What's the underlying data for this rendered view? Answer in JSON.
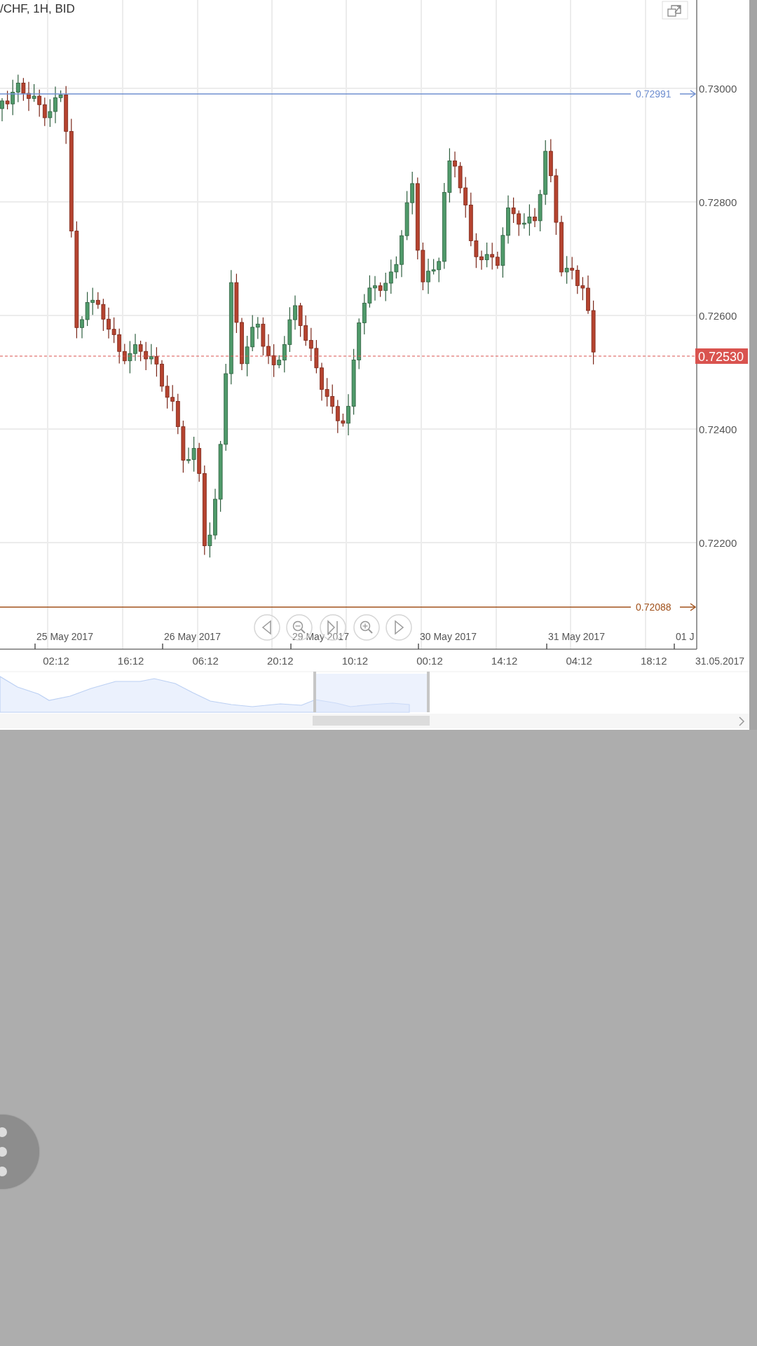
{
  "chart": {
    "title": "/CHF, 1H, BID",
    "y_labels": [
      "0.73000",
      "0.72800",
      "0.72600",
      "0.72400",
      "0.72200"
    ],
    "price_lines": [
      {
        "kind": "high",
        "label": "0.72991",
        "color": "#6f8fd0"
      },
      {
        "kind": "last",
        "label": "0.72530",
        "color": "#d9534f"
      },
      {
        "kind": "low",
        "label": "0.72088",
        "color": "#a0501a"
      }
    ],
    "date_labels": [
      "25 May 2017",
      "26 May 2017",
      "29 May 2017",
      "30 May 2017",
      "31 May 2017",
      "01 J"
    ],
    "time_labels": [
      "02:12",
      "16:12",
      "06:12",
      "20:12",
      "10:12",
      "00:12",
      "14:12",
      "04:12",
      "18:12"
    ],
    "date_stamp": "31.05.2017"
  }
}
